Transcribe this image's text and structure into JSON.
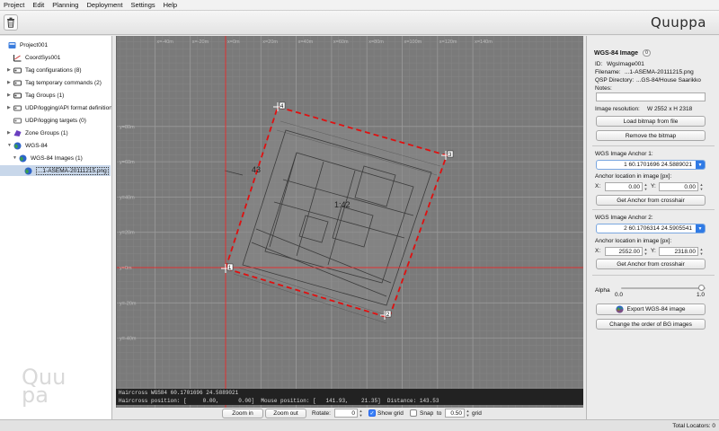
{
  "menu": [
    "Project",
    "Edit",
    "Planning",
    "Deployment",
    "Settings",
    "Help"
  ],
  "brand": "Quuppa",
  "tree": [
    {
      "label": "Project001",
      "icon": "project-icon",
      "depth": 0,
      "arrow": ""
    },
    {
      "label": "CoordSys001",
      "icon": "coordsys-icon",
      "depth": 1,
      "arrow": ""
    },
    {
      "label": "Tag configurations (8)",
      "icon": "tag-config-icon",
      "depth": 1,
      "arrow": "▶"
    },
    {
      "label": "Tag temporary commands (2)",
      "icon": "tag-commands-icon",
      "depth": 1,
      "arrow": "▶"
    },
    {
      "label": "Tag Groups (1)",
      "icon": "tag-groups-icon",
      "depth": 1,
      "arrow": "▶"
    },
    {
      "label": "UDP/logging/API format definitions (5",
      "icon": "format-icon",
      "depth": 1,
      "arrow": "▶"
    },
    {
      "label": "UDP/logging targets (0)",
      "icon": "target-icon",
      "depth": 1,
      "arrow": ""
    },
    {
      "label": "Zone Groups (1)",
      "icon": "zone-groups-icon",
      "depth": 1,
      "arrow": "▶"
    },
    {
      "label": "WGS-84",
      "icon": "globe-icon",
      "depth": 1,
      "arrow": "▼"
    },
    {
      "label": "WGS-84 Images (1)",
      "icon": "globe-icon",
      "depth": 2,
      "arrow": "▼"
    },
    {
      "label": "...1-ASEMA-20111215.png",
      "icon": "globe-icon",
      "depth": 3,
      "arrow": "",
      "selected": true
    }
  ],
  "watermark": "Quu\npa",
  "canvas": {
    "x_ticks": [
      "x=-40m",
      "x=-20m",
      "x=0m",
      "x=20m",
      "x=40m",
      "x=60m",
      "x=80m",
      "x=100m",
      "x=120m",
      "x=140m"
    ],
    "y_ticks": [
      "y=80m",
      "y=60m",
      "y=40m",
      "y=20m",
      "y=0m",
      "y=-20m",
      "y=-40m"
    ],
    "anchor_labels": [
      "1",
      "2",
      "3",
      "4"
    ],
    "plan_labels": [
      "43",
      "1:42"
    ]
  },
  "info": {
    "line1": "Haircross WGS84 60.1701696 24.5889021",
    "line2": "Haircross position: [     0.00,      0.00]  Mouse position: [   141.93,    21.35]  Distance: 143.53"
  },
  "controls": {
    "zoom_in": "Zoom in",
    "zoom_out": "Zoom out",
    "rotate_label": "Rotate:",
    "rotate_value": "0",
    "show_grid": "Show grid",
    "show_grid_checked": true,
    "snap_label": "Snap",
    "snap_to": "to",
    "snap_value": "0.50",
    "grid_label": "grid"
  },
  "status": {
    "total_locators": "Total Locators: 0"
  },
  "panel": {
    "title": "WGS-84 Image",
    "title_badge": "0",
    "id_label": "ID:",
    "id_value": "WgsImage001",
    "filename_label": "Filename:",
    "filename_value": "...1-ASEMA-20111215.png",
    "qsp_label": "QSP Directory:",
    "qsp_value": "...GS-84/House Saarikko",
    "notes_label": "Notes:",
    "resolution_label": "Image resolution:",
    "resolution_value": "W 2552 x H 2318",
    "load_bitmap": "Load bitmap from file",
    "remove_bitmap": "Remove the bitmap",
    "anchor1_title": "WGS Image Anchor 1:",
    "anchor1_value": "1 60.1701696 24.5889021",
    "anchor1_loc_label": "Anchor location in image [px]:",
    "anchor1_x": "0.00",
    "anchor1_y": "0.00",
    "get_anchor": "Get Anchor from crosshair",
    "anchor2_title": "WGS Image Anchor 2:",
    "anchor2_value": "2 60.1706314 24.5905541",
    "anchor2_loc_label": "Anchor location in image [px]:",
    "anchor2_x": "2552.00",
    "anchor2_y": "2318.00",
    "x_label": "X:",
    "y_label": "Y:",
    "alpha_label": "Alpha",
    "alpha_min": "0.0",
    "alpha_max": "1.0",
    "alpha_value": 1.0,
    "export_button": "Export WGS-84 image",
    "change_order_button": "Change the order of BG images"
  },
  "colors": {
    "accent": "#2f7ae5",
    "boundary": "#e01010",
    "axis": "#e03030",
    "canvas_bg": "#7a7a7a"
  }
}
